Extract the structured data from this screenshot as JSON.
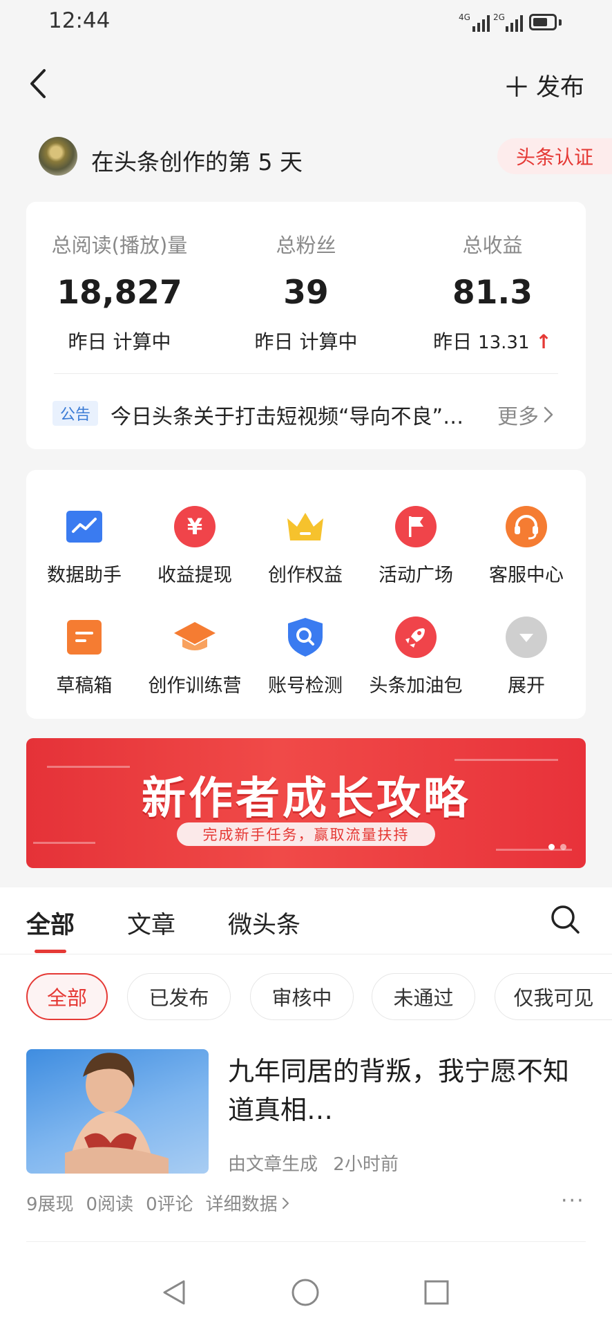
{
  "status_bar": {
    "time": "12:44",
    "signal_1": "4G",
    "signal_2": "2G"
  },
  "nav": {
    "publish_label": "发布"
  },
  "profile": {
    "days_text": "在头条创作的第 5 天",
    "cert_label": "头条认证"
  },
  "stats": [
    {
      "label": "总阅读(播放)量",
      "value": "18,827",
      "sub": "昨日 计算中"
    },
    {
      "label": "总粉丝",
      "value": "39",
      "sub": "昨日 计算中"
    },
    {
      "label": "总收益",
      "value": "81.3",
      "sub_prefix": "昨日",
      "sub_value": "13.31",
      "trend": "up"
    }
  ],
  "notice": {
    "tag": "公告",
    "text": "今日头条关于打击短视频“导向不良”…",
    "more": "更多"
  },
  "tools": [
    {
      "name": "数据助手",
      "icon": "chart-icon",
      "color": "#3a7bf0"
    },
    {
      "name": "收益提现",
      "icon": "yuan-icon",
      "color": "#f0444a"
    },
    {
      "name": "创作权益",
      "icon": "crown-icon",
      "color": "#f6c22d"
    },
    {
      "name": "活动广场",
      "icon": "flag-icon",
      "color": "#f0444a"
    },
    {
      "name": "客服中心",
      "icon": "headset-icon",
      "color": "#f57c32"
    },
    {
      "name": "草稿箱",
      "icon": "draft-icon",
      "color": "#f57c32"
    },
    {
      "name": "创作训练营",
      "icon": "graduation-cap-icon",
      "color": "#f57c32"
    },
    {
      "name": "账号检测",
      "icon": "shield-search-icon",
      "color": "#3a7bf0"
    },
    {
      "name": "头条加油包",
      "icon": "rocket-icon",
      "color": "#f0444a"
    },
    {
      "name": "展开",
      "icon": "expand-icon",
      "color": "#cfcfcf"
    }
  ],
  "banner": {
    "title": "新作者成长攻略",
    "subtitle": "完成新手任务，赢取流量扶持"
  },
  "tabs": [
    {
      "label": "全部",
      "active": true
    },
    {
      "label": "文章",
      "active": false
    },
    {
      "label": "微头条",
      "active": false
    }
  ],
  "filters": [
    {
      "label": "全部",
      "active": true
    },
    {
      "label": "已发布",
      "active": false
    },
    {
      "label": "审核中",
      "active": false
    },
    {
      "label": "未通过",
      "active": false
    },
    {
      "label": "仅我可见",
      "active": false
    }
  ],
  "article": {
    "title": "九年同居的背叛，我宁愿不知道真相…",
    "source": "由文章生成",
    "time": "2小时前",
    "impressions": "9展现",
    "reads": "0阅读",
    "comments": "0评论",
    "details_link": "详细数据"
  },
  "colors": {
    "accent": "#e53935",
    "link_blue": "#3a7bd5"
  }
}
